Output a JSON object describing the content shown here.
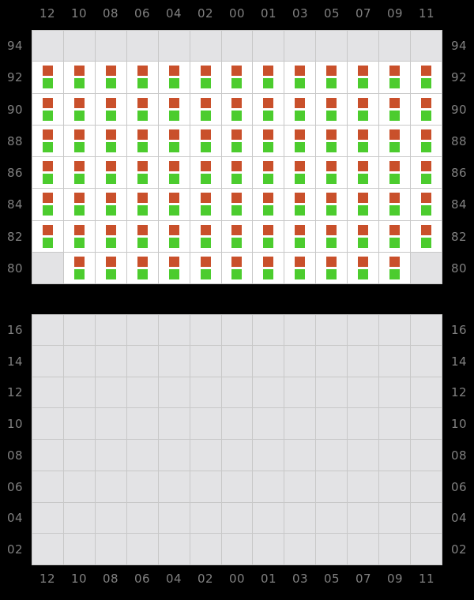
{
  "theme": {
    "background": "#000000",
    "grid_line": "#c8c8c8",
    "cell_empty": "#e3e3e5",
    "cell_filled": "#ffffff",
    "label_color": "#808080",
    "marker_up_color": "#c9502b",
    "marker_down_color": "#4ccc2e"
  },
  "column_labels": [
    "12",
    "10",
    "08",
    "06",
    "04",
    "02",
    "00",
    "01",
    "03",
    "05",
    "07",
    "09",
    "11"
  ],
  "panels": [
    {
      "id": "top",
      "row_labels": [
        "94",
        "92",
        "90",
        "88",
        "86",
        "84",
        "82",
        "80"
      ],
      "rows": [
        [
          0,
          0,
          0,
          0,
          0,
          0,
          0,
          0,
          0,
          0,
          0,
          0,
          0
        ],
        [
          1,
          1,
          1,
          1,
          1,
          1,
          1,
          1,
          1,
          1,
          1,
          1,
          1
        ],
        [
          1,
          1,
          1,
          1,
          1,
          1,
          1,
          1,
          1,
          1,
          1,
          1,
          1
        ],
        [
          1,
          1,
          1,
          1,
          1,
          1,
          1,
          1,
          1,
          1,
          1,
          1,
          1
        ],
        [
          1,
          1,
          1,
          1,
          1,
          1,
          1,
          1,
          1,
          1,
          1,
          1,
          1
        ],
        [
          1,
          1,
          1,
          1,
          1,
          1,
          1,
          1,
          1,
          1,
          1,
          1,
          1
        ],
        [
          1,
          1,
          1,
          1,
          1,
          1,
          1,
          1,
          1,
          1,
          1,
          1,
          1
        ],
        [
          0,
          1,
          1,
          1,
          1,
          1,
          1,
          1,
          1,
          1,
          1,
          1,
          0
        ]
      ]
    },
    {
      "id": "bottom",
      "row_labels": [
        "16",
        "14",
        "12",
        "10",
        "08",
        "06",
        "04",
        "02"
      ],
      "rows": [
        [
          0,
          0,
          0,
          0,
          0,
          0,
          0,
          0,
          0,
          0,
          0,
          0,
          0
        ],
        [
          0,
          0,
          0,
          0,
          0,
          0,
          0,
          0,
          0,
          0,
          0,
          0,
          0
        ],
        [
          0,
          0,
          0,
          0,
          0,
          0,
          0,
          0,
          0,
          0,
          0,
          0,
          0
        ],
        [
          0,
          0,
          0,
          0,
          0,
          0,
          0,
          0,
          0,
          0,
          0,
          0,
          0
        ],
        [
          0,
          0,
          0,
          0,
          0,
          0,
          0,
          0,
          0,
          0,
          0,
          0,
          0
        ],
        [
          0,
          0,
          0,
          0,
          0,
          0,
          0,
          0,
          0,
          0,
          0,
          0,
          0
        ],
        [
          0,
          0,
          0,
          0,
          0,
          0,
          0,
          0,
          0,
          0,
          0,
          0,
          0
        ],
        [
          0,
          0,
          0,
          0,
          0,
          0,
          0,
          0,
          0,
          0,
          0,
          0,
          0
        ]
      ]
    }
  ],
  "chart_data": {
    "type": "heatmap",
    "title": "",
    "xlabel": "",
    "ylabel": "",
    "grid": true,
    "legend_position": "none",
    "x": [
      "12",
      "10",
      "08",
      "06",
      "04",
      "02",
      "00",
      "01",
      "03",
      "05",
      "07",
      "09",
      "11"
    ],
    "panels": [
      {
        "name": "top",
        "y": [
          "94",
          "92",
          "90",
          "88",
          "86",
          "84",
          "82",
          "80"
        ],
        "values": [
          [
            0,
            0,
            0,
            0,
            0,
            0,
            0,
            0,
            0,
            0,
            0,
            0,
            0
          ],
          [
            1,
            1,
            1,
            1,
            1,
            1,
            1,
            1,
            1,
            1,
            1,
            1,
            1
          ],
          [
            1,
            1,
            1,
            1,
            1,
            1,
            1,
            1,
            1,
            1,
            1,
            1,
            1
          ],
          [
            1,
            1,
            1,
            1,
            1,
            1,
            1,
            1,
            1,
            1,
            1,
            1,
            1
          ],
          [
            1,
            1,
            1,
            1,
            1,
            1,
            1,
            1,
            1,
            1,
            1,
            1,
            1
          ],
          [
            1,
            1,
            1,
            1,
            1,
            1,
            1,
            1,
            1,
            1,
            1,
            1,
            1
          ],
          [
            1,
            1,
            1,
            1,
            1,
            1,
            1,
            1,
            1,
            1,
            1,
            1,
            1
          ],
          [
            0,
            1,
            1,
            1,
            1,
            1,
            1,
            1,
            1,
            1,
            1,
            1,
            0
          ]
        ]
      },
      {
        "name": "bottom",
        "y": [
          "16",
          "14",
          "12",
          "10",
          "08",
          "06",
          "04",
          "02"
        ],
        "values": [
          [
            0,
            0,
            0,
            0,
            0,
            0,
            0,
            0,
            0,
            0,
            0,
            0,
            0
          ],
          [
            0,
            0,
            0,
            0,
            0,
            0,
            0,
            0,
            0,
            0,
            0,
            0,
            0
          ],
          [
            0,
            0,
            0,
            0,
            0,
            0,
            0,
            0,
            0,
            0,
            0,
            0,
            0
          ],
          [
            0,
            0,
            0,
            0,
            0,
            0,
            0,
            0,
            0,
            0,
            0,
            0,
            0
          ],
          [
            0,
            0,
            0,
            0,
            0,
            0,
            0,
            0,
            0,
            0,
            0,
            0,
            0
          ],
          [
            0,
            0,
            0,
            0,
            0,
            0,
            0,
            0,
            0,
            0,
            0,
            0,
            0
          ],
          [
            0,
            0,
            0,
            0,
            0,
            0,
            0,
            0,
            0,
            0,
            0,
            0,
            0
          ],
          [
            0,
            0,
            0,
            0,
            0,
            0,
            0,
            0,
            0,
            0,
            0,
            0,
            0
          ]
        ]
      }
    ],
    "cell_legend": {
      "filled": "red-square-over-green-square",
      "empty": "blank"
    }
  }
}
